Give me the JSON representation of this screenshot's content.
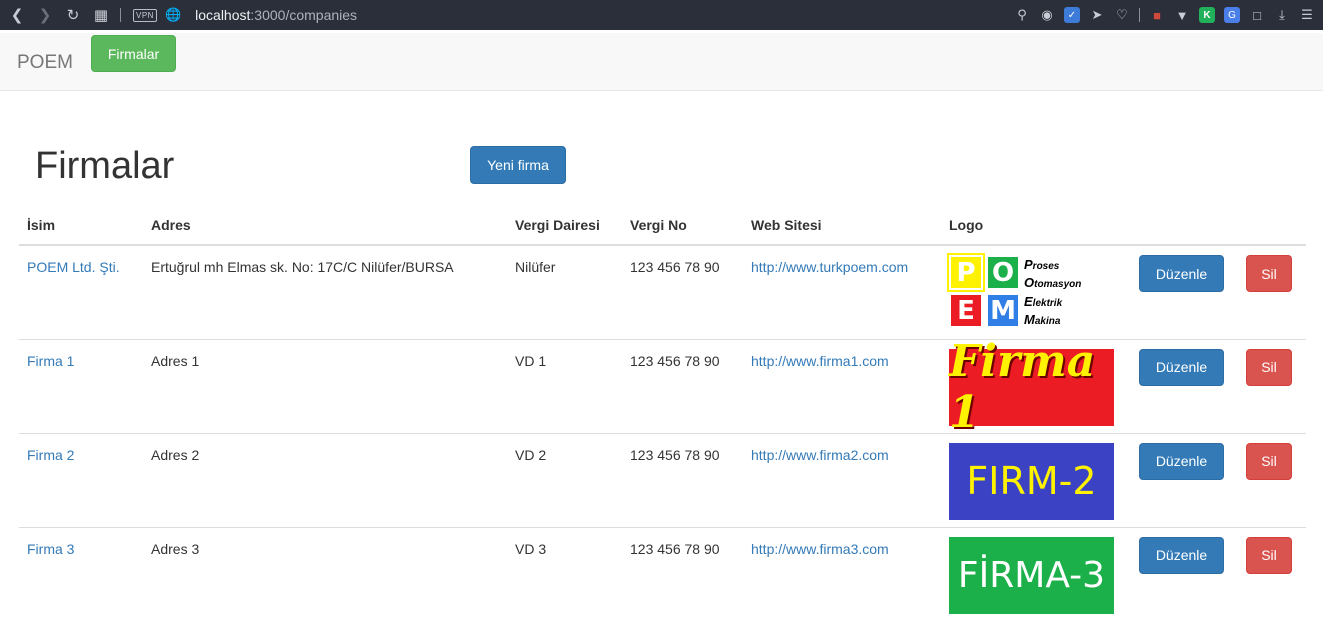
{
  "browser": {
    "url_host": "localhost",
    "url_path": ":3000/companies",
    "vpn_label": "VPN"
  },
  "navbar": {
    "brand": "POEM",
    "firmalar_label": "Firmalar"
  },
  "page": {
    "title": "Firmalar",
    "new_button": "Yeni firma"
  },
  "table": {
    "headers": [
      "İsim",
      "Adres",
      "Vergi Dairesi",
      "Vergi No",
      "Web Sitesi",
      "Logo"
    ],
    "rows": [
      {
        "name": "POEM Ltd. Şti.",
        "address": "Ertuğrul mh Elmas sk. No: 17C/C Nilüfer/BURSA",
        "tax_office": "Nilüfer",
        "tax_no": "123 456 78 90",
        "website": "http://www.turkpoem.com",
        "edit": "Düzenle",
        "delete": "Sil"
      },
      {
        "name": "Firma 1",
        "address": "Adres 1",
        "tax_office": "VD 1",
        "tax_no": "123 456 78 90",
        "website": "http://www.firma1.com",
        "edit": "Düzenle",
        "delete": "Sil"
      },
      {
        "name": "Firma 2",
        "address": "Adres 2",
        "tax_office": "VD 2",
        "tax_no": "123 456 78 90",
        "website": "http://www.firma2.com",
        "edit": "Düzenle",
        "delete": "Sil"
      },
      {
        "name": "Firma 3",
        "address": "Adres 3",
        "tax_office": "VD 3",
        "tax_no": "123 456 78 90",
        "website": "http://www.firma3.com",
        "edit": "Düzenle",
        "delete": "Sil"
      }
    ]
  },
  "logos": {
    "poem_letters": [
      "P",
      "O",
      "E",
      "M"
    ],
    "poem_words": [
      {
        "initial": "P",
        "rest": "roses"
      },
      {
        "initial": "O",
        "rest": "tomasyon"
      },
      {
        "initial": "E",
        "rest": "lektrik"
      },
      {
        "initial": "M",
        "rest": "akina"
      }
    ],
    "firma1": "Firma 1",
    "firma2": "FIRM-2",
    "firma3": "FİRMA-3"
  },
  "colors": {
    "primary": "#337ab7",
    "success": "#5cb85c",
    "danger": "#d9534f"
  }
}
